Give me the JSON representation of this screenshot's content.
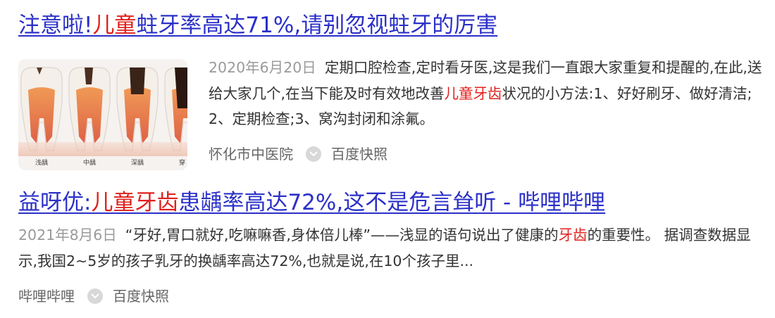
{
  "results": [
    {
      "title_parts": [
        {
          "text": "注意啦!",
          "hl": false
        },
        {
          "text": "儿童",
          "hl": true
        },
        {
          "text": "蛀牙率高达71%,请别忽视蛀牙的厉害",
          "hl": false
        }
      ],
      "thumb_captions": [
        "浅龋",
        "中龋",
        "深龋",
        "穿"
      ],
      "date": "2020年6月20日",
      "abstract_parts": [
        {
          "text": "定期口腔检查,定时看牙医,这是我们一直跟大家重复和提醒的,在此,送给大家几个,在当下能及时有效地改善",
          "hl": false
        },
        {
          "text": "儿童牙齿",
          "hl": true
        },
        {
          "text": "状况的小方法:1、好好刷牙、做好清洁;2、定期检查;3、窝沟封闭和涂氟。",
          "hl": false
        }
      ],
      "source": "怀化市中医院",
      "snapshot_label": "百度快照"
    },
    {
      "title_parts": [
        {
          "text": "益呀优:",
          "hl": false
        },
        {
          "text": "儿童牙齿",
          "hl": true
        },
        {
          "text": "患龋率高达72%,这不是危言耸听 - 哔哩哔哩",
          "hl": false
        }
      ],
      "date": "2021年8月6日",
      "abstract_parts": [
        {
          "text": "“牙好,胃口就好,吃嘛嘛香,身体倍儿棒”——浅显的语句说出了健康的",
          "hl": false
        },
        {
          "text": "牙齿",
          "hl": true
        },
        {
          "text": "的重要性。 据调查数据显示,我国2~5岁的孩子乳牙的换龋率高达72%,也就是说,在10个孩子里...",
          "hl": false
        }
      ],
      "source": "哔哩哔哩",
      "snapshot_label": "百度快照"
    }
  ],
  "colors": {
    "link": "#2b30c8",
    "highlight": "#e0201c",
    "date": "#9a9a9a",
    "source": "#666666"
  },
  "icons": {
    "snapshot": "snapshot-chevron-icon"
  }
}
